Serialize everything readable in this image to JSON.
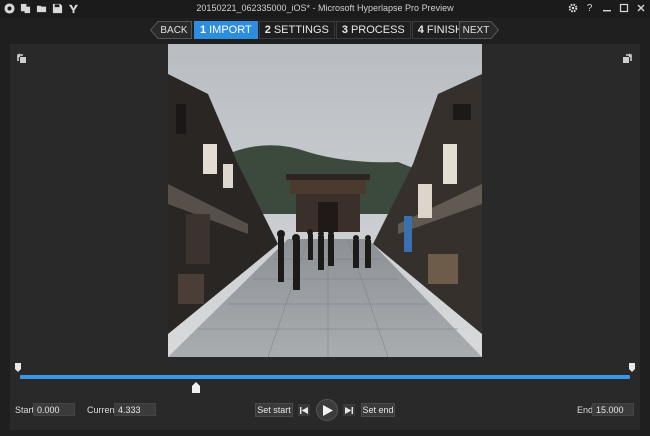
{
  "window": {
    "title": "20150221_062335000_iOS* - Microsoft Hyperlapse Pro Preview",
    "controls": {
      "settings_icon": "gear-icon",
      "help_label": "?",
      "minimize_icon": "minimize-icon",
      "maximize_icon": "maximize-icon",
      "close_icon": "close-icon"
    }
  },
  "toolbar": {
    "icons": [
      "app-logo-icon",
      "new-project-icon",
      "open-folder-icon",
      "save-icon",
      "batch-icon"
    ]
  },
  "nav": {
    "back_label": "BACK",
    "next_label": "NEXT",
    "steps": [
      {
        "num": "1",
        "label": "IMPORT",
        "active": true
      },
      {
        "num": "2",
        "label": "SETTINGS",
        "active": false
      },
      {
        "num": "3",
        "label": "PROCESS",
        "active": false
      },
      {
        "num": "4",
        "label": "FINISH",
        "active": false
      }
    ]
  },
  "timeline": {
    "start_label": "Start",
    "start_value": "0.000",
    "current_label": "Current",
    "current_value": "4.333",
    "end_label": "End",
    "end_value": "15.000",
    "set_start_label": "Set start",
    "set_end_label": "Set end",
    "playhead_fraction": 0.289
  },
  "colors": {
    "accent": "#2d8ee0",
    "track": "#3a96e6",
    "background": "#1f1f1f",
    "panel": "#292929"
  }
}
